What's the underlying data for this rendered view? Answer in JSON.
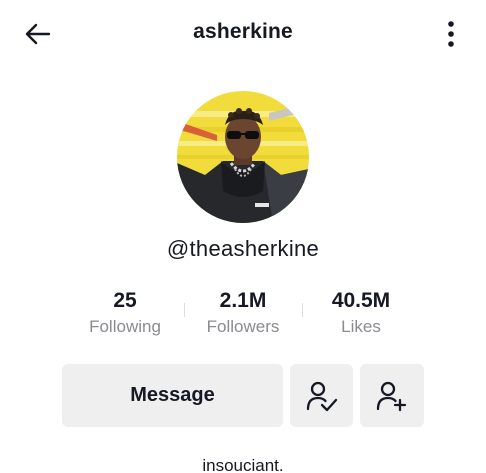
{
  "header": {
    "title": "asherkine",
    "back_icon": "arrow-left-icon",
    "more_icon": "more-vertical-icon"
  },
  "profile": {
    "avatar_icon": "profile-photo",
    "username": "@theasherkine",
    "bio": "insouciant."
  },
  "stats": [
    {
      "value": "25",
      "label": "Following"
    },
    {
      "value": "2.1M",
      "label": "Followers"
    },
    {
      "value": "40.5M",
      "label": "Likes"
    }
  ],
  "actions": {
    "message_label": "Message",
    "friends_icon": "user-check-icon",
    "add_friend_icon": "user-plus-icon"
  },
  "colors": {
    "text": "#161823",
    "secondary_text": "#8a8b91",
    "button_bg": "#efeff0"
  }
}
